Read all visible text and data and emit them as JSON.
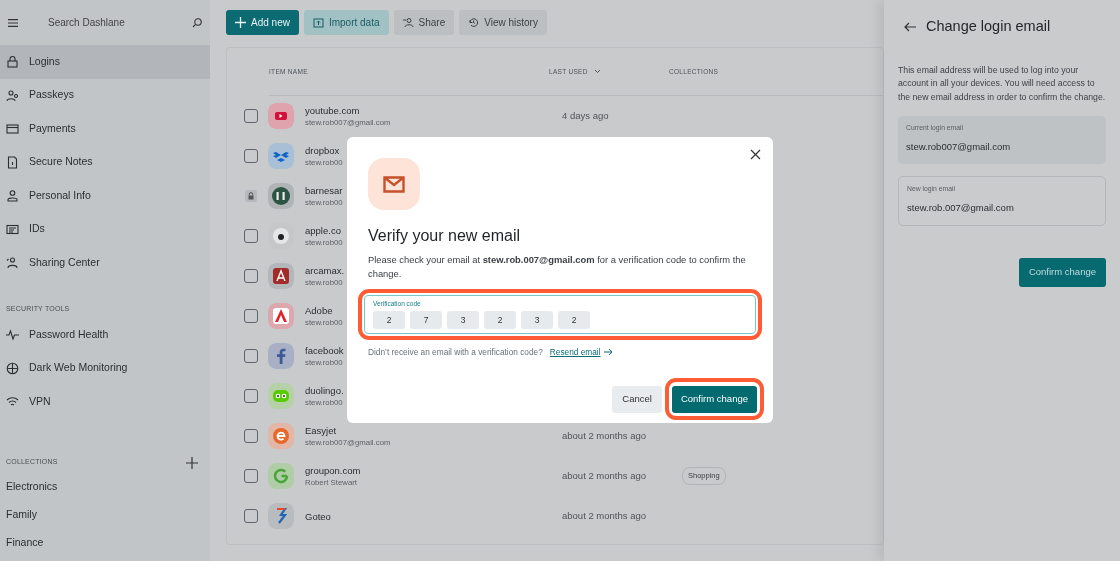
{
  "sidebar": {
    "search_placeholder": "Search Dashlane",
    "items": [
      {
        "label": "Logins",
        "selected": true
      },
      {
        "label": "Passkeys",
        "selected": false
      },
      {
        "label": "Payments",
        "selected": false
      },
      {
        "label": "Secure Notes",
        "selected": false
      },
      {
        "label": "Personal Info",
        "selected": false
      },
      {
        "label": "IDs",
        "selected": false
      },
      {
        "label": "Sharing Center",
        "selected": false
      }
    ],
    "security_tools": {
      "heading": "SECURITY TOOLS",
      "items": [
        {
          "label": "Password Health",
          "selected": false
        },
        {
          "label": "Dark Web Monitoring",
          "selected": false
        },
        {
          "label": "VPN",
          "selected": false
        }
      ]
    },
    "collections": {
      "heading": "COLLECTIONS",
      "items": [
        {
          "label": "Electronics",
          "selected": false
        },
        {
          "label": "Family",
          "selected": false
        },
        {
          "label": "Finance",
          "selected": false
        }
      ]
    }
  },
  "toolbar": [
    {
      "label": "Add new",
      "kind": "primary"
    },
    {
      "label": "Import data",
      "kind": "secondary"
    },
    {
      "label": "Share",
      "kind": "plain"
    },
    {
      "label": "View history",
      "kind": "plain"
    }
  ],
  "table": {
    "columns": [
      "ITEM NAME",
      "LAST USED",
      "COLLECTIONS"
    ],
    "rows": [
      {
        "name": "youtube.com",
        "subtitle": "stew.rob007@gmail.com",
        "last_used": "4 days ago",
        "locked": false
      },
      {
        "name": "dropbox",
        "subtitle": "stew.rob00",
        "locked": false
      },
      {
        "name": "barnesar",
        "subtitle": "stew.rob00",
        "locked": true
      },
      {
        "name": "apple.co",
        "subtitle": "stew.rob00",
        "locked": false
      },
      {
        "name": "arcamax.",
        "subtitle": "stew.rob00",
        "locked": false
      },
      {
        "name": "Adobe",
        "subtitle": "stew.rob00",
        "locked": false
      },
      {
        "name": "facebook",
        "subtitle": "stew.rob00",
        "locked": false
      },
      {
        "name": "duolingo.",
        "subtitle": "stew.rob00",
        "locked": false
      },
      {
        "name": "Easyjet",
        "subtitle": "stew.rob007@gmail.com",
        "last_used": "about 2 months ago",
        "locked": false
      },
      {
        "name": "groupon.com",
        "subtitle": "Robert Stewart",
        "last_used": "about 2 months ago",
        "collection": "Shopping",
        "locked": false
      },
      {
        "name": "Goteo",
        "last_used": "about 2 months ago",
        "locked": false
      }
    ]
  },
  "modal": {
    "title": "Verify your new email",
    "text": "Please check your email at **stew.rob.007@gmail.com** for a verification code to confirm the change.",
    "code_label": "Verification code",
    "digits": [
      "2",
      "7",
      "3",
      "2",
      "3",
      "2"
    ],
    "hint": "Didn’t receive an email with a verification code?",
    "link": "Resend email",
    "cancel": "Cancel",
    "confirm": "Confirm change"
  },
  "panel": {
    "title": "Change login email",
    "description": "This email address will be used to log into your account in all your devices. You will need access to the new email address in order to confirm the change.",
    "current": {
      "label": "Current login email",
      "value": "stew.rob007@gmail.com"
    },
    "new": {
      "label": "New login email",
      "value": "stew.rob.007@gmail.com"
    },
    "button": "Confirm change"
  }
}
